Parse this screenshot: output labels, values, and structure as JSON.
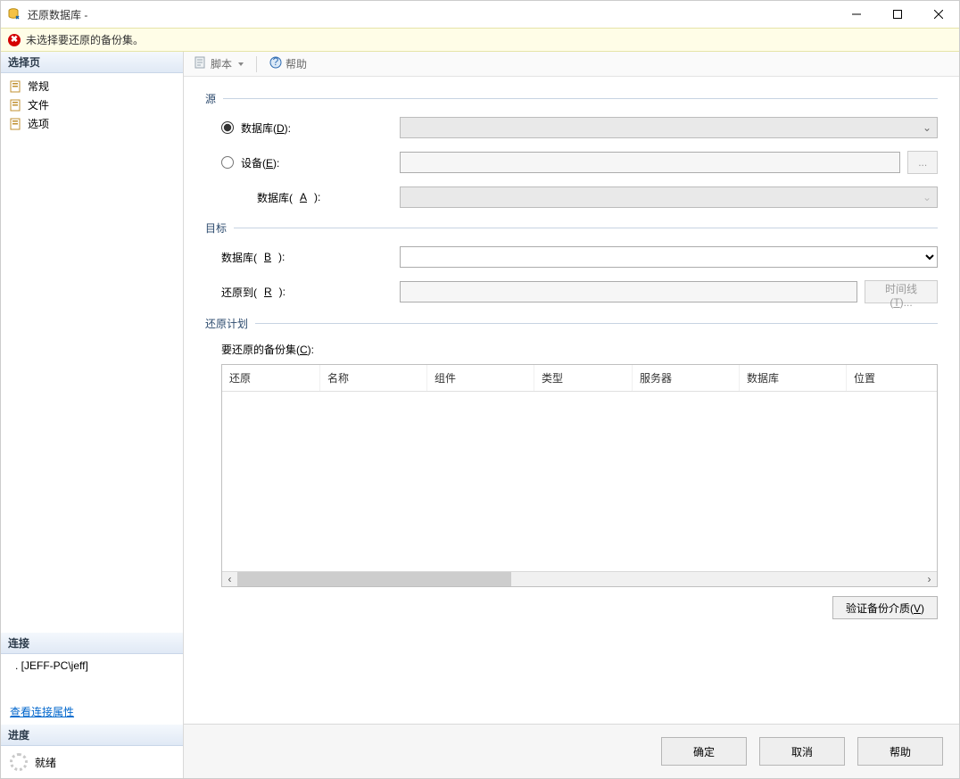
{
  "window": {
    "title": "还原数据库 - "
  },
  "error_bar": {
    "message": "未选择要还原的备份集。"
  },
  "sidebar": {
    "select_page_header": "选择页",
    "items": [
      {
        "label": "常规"
      },
      {
        "label": "文件"
      },
      {
        "label": "选项"
      }
    ],
    "connection_header": "连接",
    "connection_value": ". [JEFF-PC\\jeff]",
    "view_connection_props": "查看连接属性",
    "progress_header": "进度",
    "progress_label": "就绪"
  },
  "toolbar": {
    "script": "脚本",
    "help": "帮助"
  },
  "source": {
    "header": "源",
    "database_radio": "数据库(",
    "database_radio_u": "D",
    "database_radio_tail": "):",
    "device_radio": "设备(",
    "device_radio_u": "E",
    "device_radio_tail": "):",
    "device_db_label": "数据库(",
    "device_db_u": "A",
    "device_db_tail": "):"
  },
  "target": {
    "header": "目标",
    "database_label": "数据库(",
    "database_u": "B",
    "database_tail": "):",
    "database_value": "",
    "restore_to_label": "还原到(",
    "restore_to_u": "R",
    "restore_to_tail": "):",
    "restore_to_value": "",
    "timeline_btn": "时间线(",
    "timeline_u": "T",
    "timeline_tail": ")...",
    "browse_btn": "..."
  },
  "plan": {
    "header": "还原计划",
    "sets_label": "要还原的备份集(",
    "sets_u": "C",
    "sets_tail": "):",
    "columns": [
      "还原",
      "名称",
      "组件",
      "类型",
      "服务器",
      "数据库",
      "位置"
    ],
    "verify_btn": "验证备份介质(",
    "verify_u": "V",
    "verify_tail": ")"
  },
  "footer": {
    "ok": "确定",
    "cancel": "取消",
    "help": "帮助"
  }
}
